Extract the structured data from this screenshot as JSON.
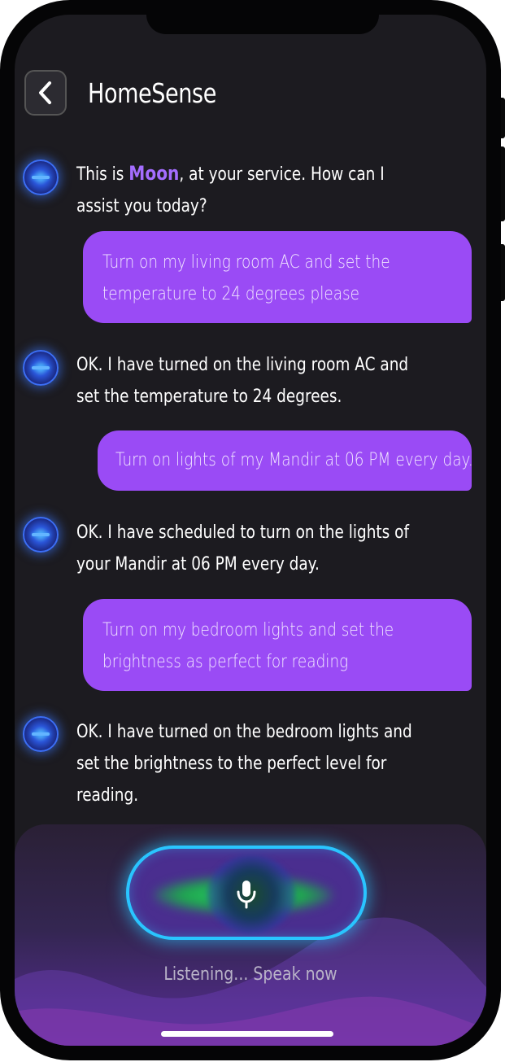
{
  "header": {
    "title": "HomeSense",
    "back_icon": "chevron-left-icon"
  },
  "messages": [
    {
      "from": "bot",
      "pre": "This is ",
      "name": "Moon",
      "post": ", at your service. How can I assist you today?"
    },
    {
      "from": "user",
      "text": "Turn on my living room AC and set the temperature to 24 degrees please"
    },
    {
      "from": "bot",
      "text": "OK. I have turned on the living room AC and set the temperature to 24 degrees."
    },
    {
      "from": "user",
      "text": "Turn on lights of my Mandir at 06 PM every day."
    },
    {
      "from": "bot",
      "text": "OK. I have scheduled to turn on the lights of your Mandir at 06 PM every day."
    },
    {
      "from": "user",
      "text": "Turn on my bedroom lights and set the brightness as perfect for reading"
    },
    {
      "from": "bot",
      "text": "OK. I have turned on the bedroom lights and set the brightness to the perfect level for reading."
    }
  ],
  "voice": {
    "status": "Listening... Speak now",
    "icon": "microphone-icon"
  },
  "colors": {
    "background": "#1c1b20",
    "user_bubble": "#9a4bf5",
    "accent_name": "#a46dff",
    "mic_ring": "#29c5ff"
  }
}
